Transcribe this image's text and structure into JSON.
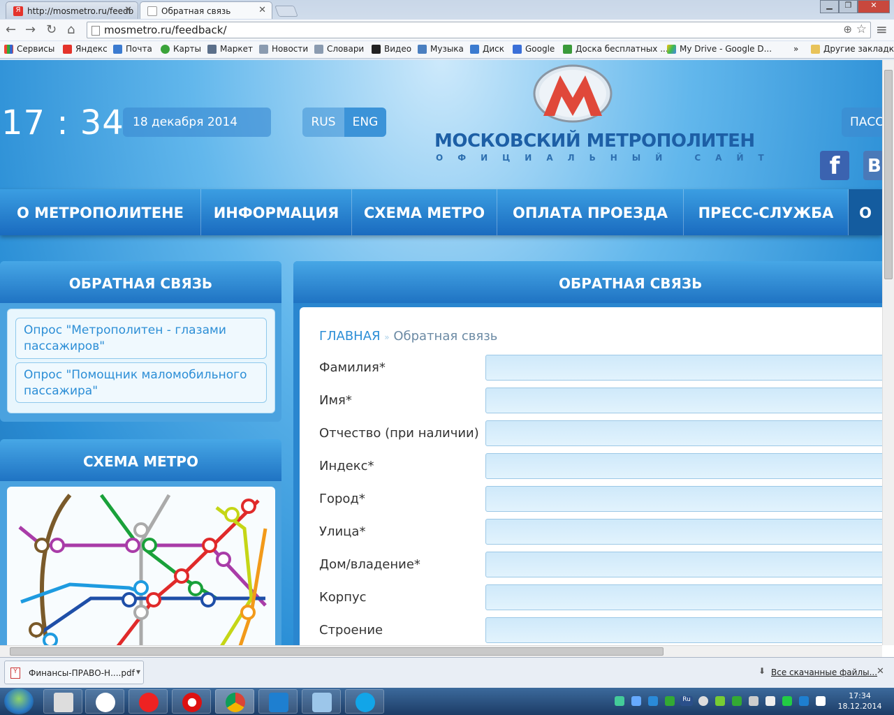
{
  "browser": {
    "tabs": [
      {
        "title": "http://mosmetro.ru/feedb"
      },
      {
        "title": "Обратная связь"
      }
    ],
    "address": "mosmetro.ru/feedback/",
    "bookmarks": [
      "Сервисы",
      "Яндекс",
      "Почта",
      "Карты",
      "Маркет",
      "Новости",
      "Словари",
      "Видео",
      "Музыка",
      "Диск",
      "Google",
      "Доска бесплатных ...",
      "My Drive - Google D...",
      "»",
      "Другие закладки"
    ]
  },
  "header": {
    "clock": "17 : 34",
    "date": "18 декабря 2014",
    "lang_rus": "RUS",
    "lang_eng": "ENG",
    "logo_m": "М",
    "logo_title": "МОСКОВСКИЙ МЕТРОПОЛИТЕН",
    "logo_subtitle": "ОФИЦИАЛЬНЫЙ САЙТ",
    "pass_label": "ПАСС",
    "facebook": "f",
    "vk": "B"
  },
  "menu": [
    "О МЕТРОПОЛИТЕНЕ",
    "ИНФОРМАЦИЯ",
    "СХЕМА МЕТРО",
    "ОПЛАТА ПРОЕЗДА",
    "ПРЕСС-СЛУЖБА",
    "О"
  ],
  "sidebar": {
    "feedback_title": "ОБРАТНАЯ СВЯЗЬ",
    "polls": [
      "Опрос \"Метрополитен - глазами пассажиров\"",
      "Опрос \"Помощник маломобильного пассажира\""
    ],
    "map_title": "СХЕМА МЕТРО"
  },
  "main": {
    "title": "ОБРАТНАЯ СВЯЗЬ",
    "breadcrumb_home": "ГЛАВНАЯ",
    "breadcrumb_sep": "»",
    "breadcrumb_current": "Обратная связь",
    "fields": [
      "Фамилия*",
      "Имя*",
      "Отчество (при наличии)",
      "Индекс*",
      "Город*",
      "Улица*",
      "Дом/владение*",
      "Корпус",
      "Строение"
    ]
  },
  "downloads": {
    "file": "Финансы-ПРАВО-Н....pdf",
    "show_all": "Все скачанные файлы..."
  },
  "taskbar": {
    "time": "17:34",
    "date": "18.12.2014",
    "tray_lang": "Ru"
  },
  "colors": {
    "brand_blue": "#1d6fb5",
    "link_blue": "#2c8ed6",
    "metro_red": "#e0483a"
  }
}
